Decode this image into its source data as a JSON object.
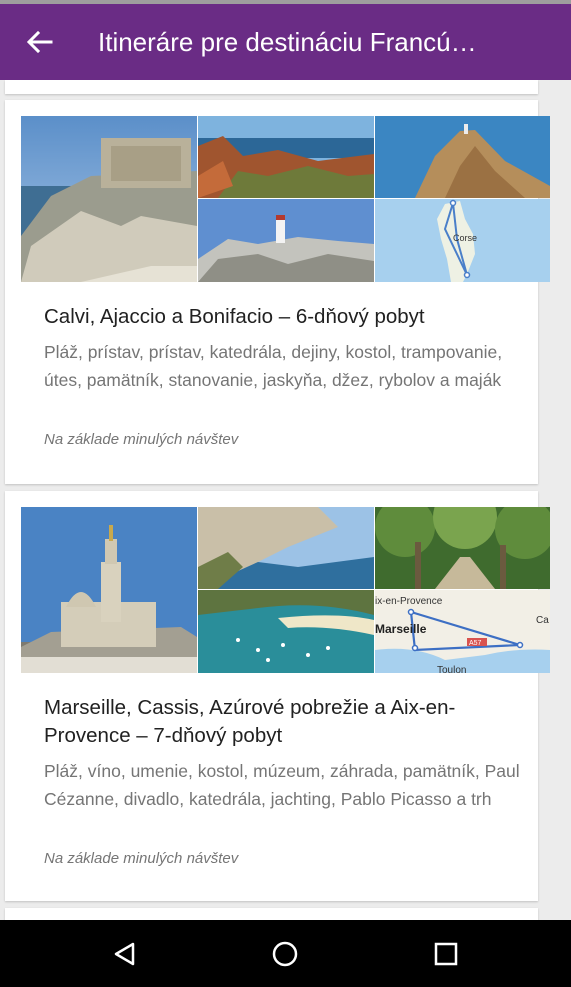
{
  "header": {
    "title": "Itineráre pre destináciu Francú…"
  },
  "cards": [
    {
      "title": "Calvi, Ajaccio a Bonifacio – 6-dňový pobyt",
      "tags": "Pláž, prístav, prístav, katedrála, dejiny, kostol, trampovanie, útes, pamätník, stanovanie, jaskyňa, džez, rybolov a maják",
      "note": "Na základe minulých návštev",
      "map_label": "Corse"
    },
    {
      "title": "Marseille, Cassis, Azúrové pobrežie a Aix-en-Provence – 7-dňový pobyt",
      "tags": "Pláž, víno, umenie, kostol, múzeum, záhrada, pamätník, Paul Cézanne, divadlo, katedrála, jachting, Pablo Picasso a trh",
      "note": "Na základe minulých návštev",
      "map_labels": {
        "city1": "ix-en-Provence",
        "city2": "Marseille",
        "city3": "Toulon",
        "city4": "Ca",
        "road": "A57"
      }
    }
  ],
  "colors": {
    "app_bar": "#6a2c85",
    "nav_bar": "#000000",
    "background": "#ececec"
  },
  "icons": {
    "back": "arrow-left-icon",
    "nav_back": "nav-back-triangle-icon",
    "nav_home": "nav-home-circle-icon",
    "nav_recents": "nav-recents-square-icon"
  }
}
